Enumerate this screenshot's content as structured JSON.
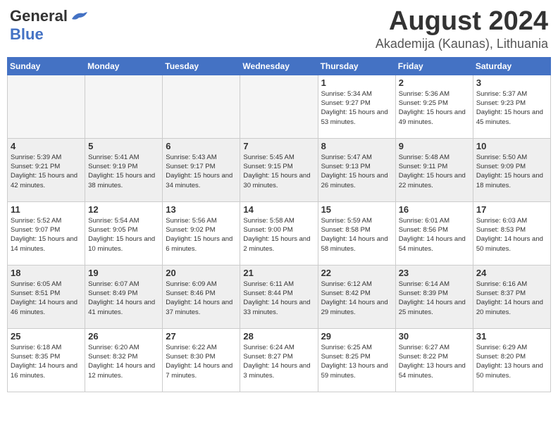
{
  "header": {
    "logo_general": "General",
    "logo_blue": "Blue",
    "month": "August 2024",
    "location": "Akademija (Kaunas), Lithuania"
  },
  "days_of_week": [
    "Sunday",
    "Monday",
    "Tuesday",
    "Wednesday",
    "Thursday",
    "Friday",
    "Saturday"
  ],
  "weeks": [
    {
      "alt": false,
      "days": [
        {
          "date": "",
          "info": ""
        },
        {
          "date": "",
          "info": ""
        },
        {
          "date": "",
          "info": ""
        },
        {
          "date": "",
          "info": ""
        },
        {
          "date": "1",
          "info": "Sunrise: 5:34 AM\nSunset: 9:27 PM\nDaylight: 15 hours\nand 53 minutes."
        },
        {
          "date": "2",
          "info": "Sunrise: 5:36 AM\nSunset: 9:25 PM\nDaylight: 15 hours\nand 49 minutes."
        },
        {
          "date": "3",
          "info": "Sunrise: 5:37 AM\nSunset: 9:23 PM\nDaylight: 15 hours\nand 45 minutes."
        }
      ]
    },
    {
      "alt": true,
      "days": [
        {
          "date": "4",
          "info": "Sunrise: 5:39 AM\nSunset: 9:21 PM\nDaylight: 15 hours\nand 42 minutes."
        },
        {
          "date": "5",
          "info": "Sunrise: 5:41 AM\nSunset: 9:19 PM\nDaylight: 15 hours\nand 38 minutes."
        },
        {
          "date": "6",
          "info": "Sunrise: 5:43 AM\nSunset: 9:17 PM\nDaylight: 15 hours\nand 34 minutes."
        },
        {
          "date": "7",
          "info": "Sunrise: 5:45 AM\nSunset: 9:15 PM\nDaylight: 15 hours\nand 30 minutes."
        },
        {
          "date": "8",
          "info": "Sunrise: 5:47 AM\nSunset: 9:13 PM\nDaylight: 15 hours\nand 26 minutes."
        },
        {
          "date": "9",
          "info": "Sunrise: 5:48 AM\nSunset: 9:11 PM\nDaylight: 15 hours\nand 22 minutes."
        },
        {
          "date": "10",
          "info": "Sunrise: 5:50 AM\nSunset: 9:09 PM\nDaylight: 15 hours\nand 18 minutes."
        }
      ]
    },
    {
      "alt": false,
      "days": [
        {
          "date": "11",
          "info": "Sunrise: 5:52 AM\nSunset: 9:07 PM\nDaylight: 15 hours\nand 14 minutes."
        },
        {
          "date": "12",
          "info": "Sunrise: 5:54 AM\nSunset: 9:05 PM\nDaylight: 15 hours\nand 10 minutes."
        },
        {
          "date": "13",
          "info": "Sunrise: 5:56 AM\nSunset: 9:02 PM\nDaylight: 15 hours\nand 6 minutes."
        },
        {
          "date": "14",
          "info": "Sunrise: 5:58 AM\nSunset: 9:00 PM\nDaylight: 15 hours\nand 2 minutes."
        },
        {
          "date": "15",
          "info": "Sunrise: 5:59 AM\nSunset: 8:58 PM\nDaylight: 14 hours\nand 58 minutes."
        },
        {
          "date": "16",
          "info": "Sunrise: 6:01 AM\nSunset: 8:56 PM\nDaylight: 14 hours\nand 54 minutes."
        },
        {
          "date": "17",
          "info": "Sunrise: 6:03 AM\nSunset: 8:53 PM\nDaylight: 14 hours\nand 50 minutes."
        }
      ]
    },
    {
      "alt": true,
      "days": [
        {
          "date": "18",
          "info": "Sunrise: 6:05 AM\nSunset: 8:51 PM\nDaylight: 14 hours\nand 46 minutes."
        },
        {
          "date": "19",
          "info": "Sunrise: 6:07 AM\nSunset: 8:49 PM\nDaylight: 14 hours\nand 41 minutes."
        },
        {
          "date": "20",
          "info": "Sunrise: 6:09 AM\nSunset: 8:46 PM\nDaylight: 14 hours\nand 37 minutes."
        },
        {
          "date": "21",
          "info": "Sunrise: 6:11 AM\nSunset: 8:44 PM\nDaylight: 14 hours\nand 33 minutes."
        },
        {
          "date": "22",
          "info": "Sunrise: 6:12 AM\nSunset: 8:42 PM\nDaylight: 14 hours\nand 29 minutes."
        },
        {
          "date": "23",
          "info": "Sunrise: 6:14 AM\nSunset: 8:39 PM\nDaylight: 14 hours\nand 25 minutes."
        },
        {
          "date": "24",
          "info": "Sunrise: 6:16 AM\nSunset: 8:37 PM\nDaylight: 14 hours\nand 20 minutes."
        }
      ]
    },
    {
      "alt": false,
      "days": [
        {
          "date": "25",
          "info": "Sunrise: 6:18 AM\nSunset: 8:35 PM\nDaylight: 14 hours\nand 16 minutes."
        },
        {
          "date": "26",
          "info": "Sunrise: 6:20 AM\nSunset: 8:32 PM\nDaylight: 14 hours\nand 12 minutes."
        },
        {
          "date": "27",
          "info": "Sunrise: 6:22 AM\nSunset: 8:30 PM\nDaylight: 14 hours\nand 7 minutes."
        },
        {
          "date": "28",
          "info": "Sunrise: 6:24 AM\nSunset: 8:27 PM\nDaylight: 14 hours\nand 3 minutes."
        },
        {
          "date": "29",
          "info": "Sunrise: 6:25 AM\nSunset: 8:25 PM\nDaylight: 13 hours\nand 59 minutes."
        },
        {
          "date": "30",
          "info": "Sunrise: 6:27 AM\nSunset: 8:22 PM\nDaylight: 13 hours\nand 54 minutes."
        },
        {
          "date": "31",
          "info": "Sunrise: 6:29 AM\nSunset: 8:20 PM\nDaylight: 13 hours\nand 50 minutes."
        }
      ]
    }
  ]
}
